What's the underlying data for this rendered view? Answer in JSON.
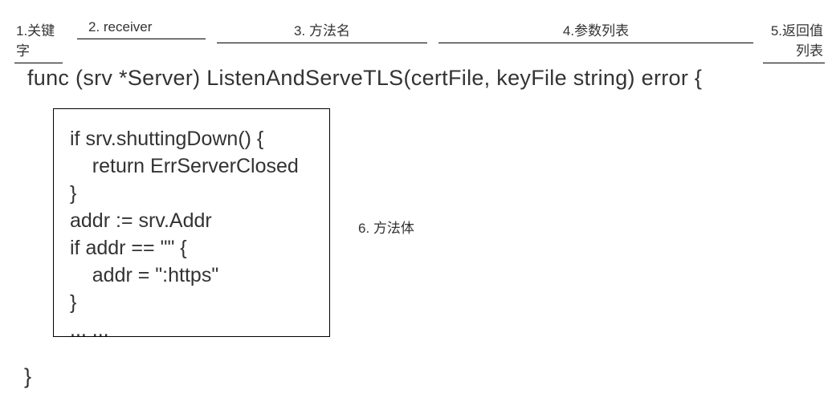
{
  "labels": {
    "l1": "1.关键字",
    "l2": "2. receiver",
    "l3": "3. 方法名",
    "l4": "4.参数列表",
    "l5": "5.返回值列表",
    "l6": "6. 方法体"
  },
  "declaration": "func (srv *Server) ListenAndServeTLS(certFile, keyFile string) error {",
  "body": "if srv.shuttingDown() {\n    return ErrServerClosed\n}\naddr := srv.Addr\nif addr == \"\" {\n    addr = \":https\"\n}\n... ...",
  "closing": "}"
}
